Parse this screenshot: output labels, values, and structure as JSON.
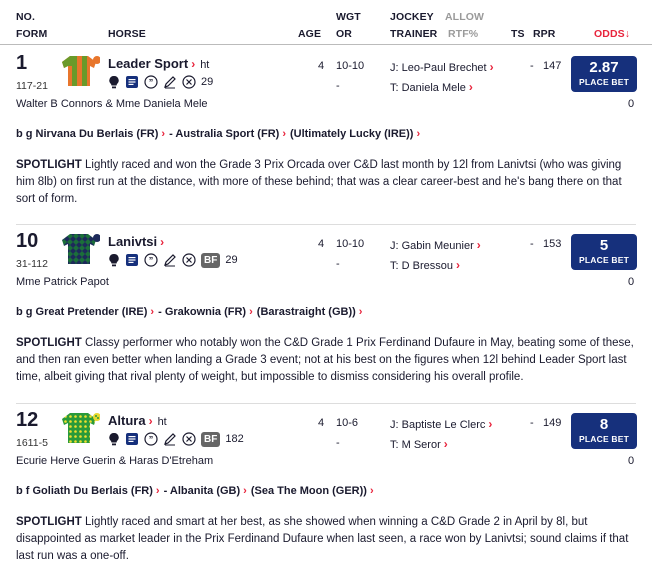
{
  "header": {
    "no": "NO.",
    "form": "FORM",
    "horse": "HORSE",
    "age": "AGE",
    "wgt": "WGT",
    "or": "OR",
    "jockey": "JOCKEY",
    "trainer": "TRAINER",
    "allow": "ALLOW",
    "rtf": "RTF%",
    "ts": "TS",
    "rpr": "RPR",
    "odds": "ODDS↓"
  },
  "place_bet_label": "PLACE BET",
  "spotlight_label": "SPOTLIGHT",
  "colors": {
    "accent": "#e8243c",
    "bet_button": "#16307c",
    "text": "#1a1a2e"
  },
  "runners": [
    {
      "number": "1",
      "form": "117-21",
      "name": "Leader Sport",
      "suffix": "ht",
      "rating": "29",
      "bf_badge": "",
      "silk": "orange-green-halves",
      "age": "4",
      "weight": "10-10",
      "or": "-",
      "jockey": "J: Leo-Paul Brechet",
      "trainer": "T: Daniela Mele",
      "ts": "-",
      "rpr": "147",
      "odds": "2.87",
      "owner": "Walter B Connors & Mme Daniela Mele",
      "owner_count": "0",
      "pedigree": [
        "b g Nirvana Du Berlais (FR)",
        "- Australia Sport (FR)",
        "(Ultimately Lucky (IRE))"
      ],
      "spotlight": "Lightly raced and won the Grade 3 Prix Orcada over C&D last month by 12l from Lanivtsi (who was giving him 8lb) on first run at the distance, with more of these behind; that was a clear career-best and he's bang there on that sort of form."
    },
    {
      "number": "10",
      "form": "31-112",
      "name": "Lanivtsi",
      "suffix": "",
      "rating": "29",
      "bf_badge": "BF",
      "silk": "green-navy-diamonds",
      "age": "4",
      "weight": "10-10",
      "or": "-",
      "jockey": "J: Gabin Meunier",
      "trainer": "T: D Bressou",
      "ts": "-",
      "rpr": "153",
      "odds": "5",
      "owner": "Mme Patrick Papot",
      "owner_count": "0",
      "pedigree": [
        "b g Great Pretender (IRE)",
        "- Grakownia (FR)",
        "(Barastraight (GB))"
      ],
      "spotlight": "Classy performer who notably won the C&D Grade 1 Prix Ferdinand Dufaure in May, beating some of these, and then ran even better when landing a Grade 3 event; not at his best on the figures when 12l behind Leader Sport last time, albeit giving that rival plenty of weight, but impossible to dismiss considering his overall profile."
    },
    {
      "number": "12",
      "form": "1611-5",
      "name": "Altura",
      "suffix": "ht",
      "rating": "182",
      "bf_badge": "BF",
      "silk": "green-yellow-spots",
      "age": "4",
      "weight": "10-6",
      "or": "-",
      "jockey": "J: Baptiste Le Clerc",
      "trainer": "T: M Seror",
      "ts": "-",
      "rpr": "149",
      "odds": "8",
      "owner": "Ecurie Herve Guerin & Haras D'Etreham",
      "owner_count": "0",
      "pedigree": [
        "b f Goliath Du Berlais (FR)",
        "- Albanita (GB)",
        "(Sea The Moon (GER))"
      ],
      "spotlight": "Lightly raced and smart at her best, as she showed when winning a C&D Grade 2 in April by 8l, but disappointed as market leader in the Prix Ferdinand Dufaure when last seen, a race won by Lanivtsi; sound claims if that last run was a one-off."
    }
  ]
}
